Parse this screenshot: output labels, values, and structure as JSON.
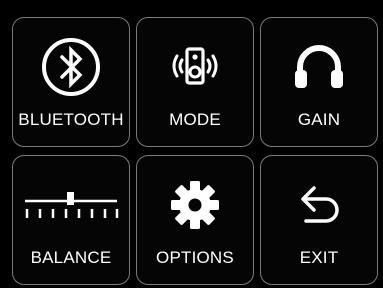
{
  "menu": {
    "tiles": [
      {
        "label": "BLUETOOTH",
        "icon": "bluetooth-icon"
      },
      {
        "label": "MODE",
        "icon": "speaker-icon"
      },
      {
        "label": "GAIN",
        "icon": "headphones-icon"
      },
      {
        "label": "BALANCE",
        "icon": "balance-slider-icon"
      },
      {
        "label": "OPTIONS",
        "icon": "gear-icon"
      },
      {
        "label": "EXIT",
        "icon": "back-arrow-icon"
      }
    ]
  },
  "colors": {
    "background": "#000000",
    "tile_border": "#7a7a7a",
    "foreground": "#ffffff"
  }
}
